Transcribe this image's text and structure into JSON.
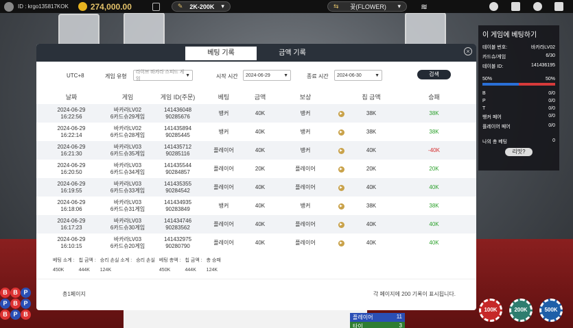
{
  "topbar": {
    "user_id": "ID : krgo135817KOK",
    "balance": "274,000.00",
    "limit": "2K-200K",
    "room": "꽃(FLOWER)"
  },
  "side_panel": {
    "title": "이 게임에 베팅하기",
    "rows": [
      {
        "label": "테이블 번호:",
        "value": "바카라LV02"
      },
      {
        "label": "카드슈/게임",
        "value": "6/30"
      },
      {
        "label": "테이블 ID:",
        "value": "141436195"
      }
    ],
    "player_pct": "50%",
    "banker_pct": "50%",
    "player_pct_value": 0.5,
    "stats": [
      {
        "label": "B",
        "value": "0/0"
      },
      {
        "label": "P",
        "value": "0/0"
      },
      {
        "label": "T",
        "value": "0/0"
      },
      {
        "label": "뱅커 페어",
        "value": "0/0"
      },
      {
        "label": "플레이어 페어",
        "value": "0/0"
      }
    ],
    "my_total_label": "나의 총 베팅",
    "my_total_value": "0",
    "more_label": "리밋?"
  },
  "modal": {
    "tab_bet_history": "베팅 기록",
    "tab_amount_history": "금액 기록",
    "close_icon": "×",
    "filters": {
      "timezone": "UTC+8",
      "game_type_label": "게임 유형",
      "game_type_value": "라이브 바카라 스피드 게임",
      "start_label": "시작 시간",
      "start_value": "2024-06-29",
      "end_label": "종료 시간",
      "end_value": "2024-06-30",
      "search_label": "검색"
    },
    "columns": [
      "날짜",
      "게임",
      "게임 ID(주문)",
      "베팅",
      "금액",
      "보상",
      "",
      "칩 금액",
      "승패"
    ],
    "rows": [
      {
        "date": "2024-06-29",
        "time": "16:22:56",
        "game": "바카라LV02",
        "shoe": "6카드슈29게임",
        "gid": "141436048",
        "order": "90285676",
        "bet": "뱅커",
        "amount": "40K",
        "reward": "뱅커",
        "chip": "38K",
        "result": "38K",
        "win": true
      },
      {
        "date": "2024-06-29",
        "time": "16:22:14",
        "game": "바카라LV02",
        "shoe": "6카드슈28게임",
        "gid": "141435894",
        "order": "90285445",
        "bet": "뱅커",
        "amount": "40K",
        "reward": "뱅커",
        "chip": "38K",
        "result": "38K",
        "win": true
      },
      {
        "date": "2024-06-29",
        "time": "16:21:30",
        "game": "바카라LV03",
        "shoe": "6카드슈35게임",
        "gid": "141435712",
        "order": "90285116",
        "bet": "플레이어",
        "amount": "40K",
        "reward": "뱅커",
        "chip": "40K",
        "result": "-40K",
        "win": false
      },
      {
        "date": "2024-06-29",
        "time": "16:20:50",
        "game": "바카라LV03",
        "shoe": "6카드슈34게임",
        "gid": "141435544",
        "order": "90284857",
        "bet": "플레이어",
        "amount": "20K",
        "reward": "플레이어",
        "chip": "20K",
        "result": "20K",
        "win": true
      },
      {
        "date": "2024-06-29",
        "time": "16:19:55",
        "game": "바카라LV03",
        "shoe": "6카드슈33게임",
        "gid": "141435355",
        "order": "90284542",
        "bet": "플레이어",
        "amount": "40K",
        "reward": "플레이어",
        "chip": "40K",
        "result": "40K",
        "win": true
      },
      {
        "date": "2024-06-29",
        "time": "16:18:06",
        "game": "바카라LV03",
        "shoe": "6카드슈31게임",
        "gid": "141434935",
        "order": "90283849",
        "bet": "뱅커",
        "amount": "40K",
        "reward": "뱅커",
        "chip": "38K",
        "result": "38K",
        "win": true
      },
      {
        "date": "2024-06-29",
        "time": "16:17:23",
        "game": "바카라LV03",
        "shoe": "6카드슈30게임",
        "gid": "141434746",
        "order": "90283562",
        "bet": "플레이어",
        "amount": "40K",
        "reward": "플레이어",
        "chip": "40K",
        "result": "40K",
        "win": true
      },
      {
        "date": "2024-06-29",
        "time": "16:10:15",
        "game": "바카라LV03",
        "shoe": "6카드슈20게임",
        "gid": "141432975",
        "order": "90280790",
        "bet": "플레이어",
        "amount": "40K",
        "reward": "플레이어",
        "chip": "40K",
        "result": "40K",
        "win": true
      }
    ],
    "summary": [
      {
        "label": "베팅 소계 :",
        "value": "450K"
      },
      {
        "label": "칩 금액 :",
        "value": "444K"
      },
      {
        "label": "승리 손실 소계 :",
        "value": "124K"
      },
      {
        "label": "승리 손실",
        "value": ""
      },
      {
        "label": "베팅 총액 :",
        "value": "450K"
      },
      {
        "label": "칩 금액 :",
        "value": "444K"
      },
      {
        "label": "총 승패",
        "value": "124K"
      }
    ],
    "page_info": "총1페이지",
    "note": "각 페이지에 200 기록이 표시됩니다."
  },
  "chips": [
    "100K",
    "200K",
    "500K"
  ],
  "scoreboard": {
    "label": "플레이어",
    "value": "11",
    "label2": "타이",
    "value2": "3"
  },
  "colors": {
    "win": "#2ba02b",
    "lose": "#d42a2a",
    "header": "#2a313a"
  }
}
